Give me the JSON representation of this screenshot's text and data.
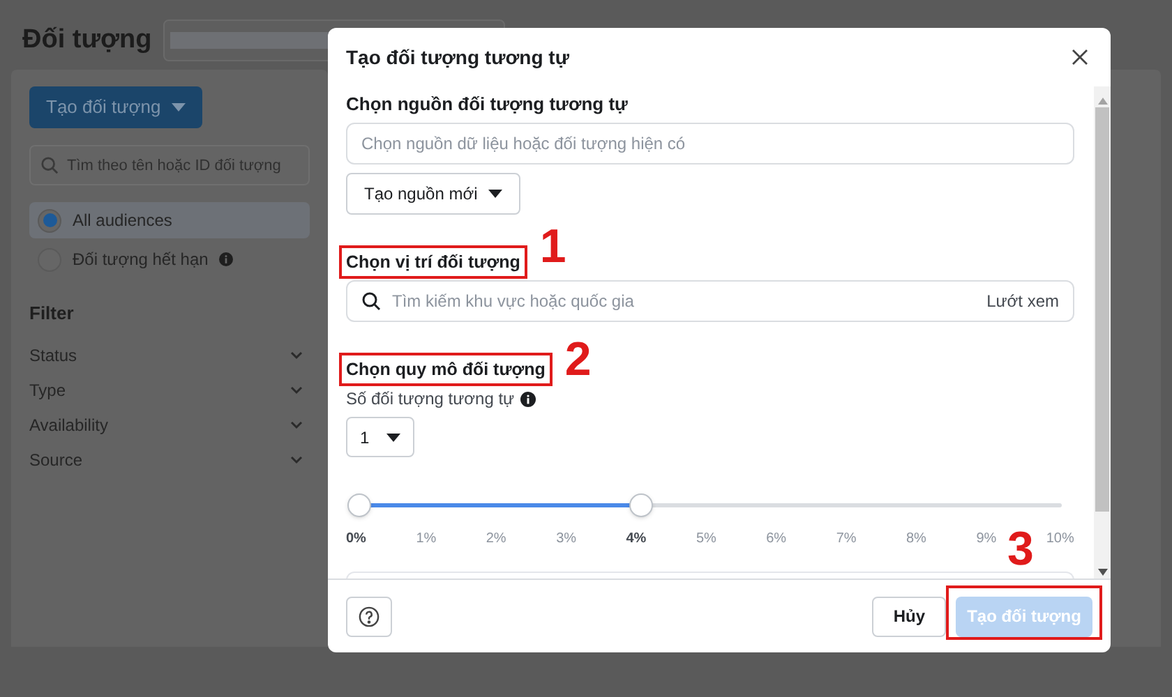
{
  "page": {
    "title": "Đối tượng",
    "create_button": "Tạo đối tượng",
    "search": {
      "placeholder": "Tìm theo tên hoặc ID đối tượng"
    },
    "views": [
      {
        "label": "All audiences",
        "selected": true,
        "info": false
      },
      {
        "label": "Đối tượng hết hạn",
        "selected": false,
        "info": true
      }
    ],
    "filter": {
      "title": "Filter",
      "items": [
        "Status",
        "Type",
        "Availability",
        "Source"
      ]
    }
  },
  "dialog": {
    "title": "Tạo đối tượng tương tự",
    "source": {
      "heading": "Chọn nguồn đối tượng tương tự",
      "placeholder": "Chọn nguồn dữ liệu hoặc đối tượng hiện có",
      "new_button": "Tạo nguồn mới"
    },
    "location": {
      "heading": "Chọn vị trí đối tượng",
      "placeholder": "Tìm kiếm khu vực hoặc quốc gia",
      "browse": "Lướt xem",
      "annotation": "1"
    },
    "size": {
      "heading": "Chọn quy mô đối tượng",
      "annotation": "2",
      "count_label": "Số đối tượng tương tự",
      "count_value": "1",
      "slider": {
        "level": 0.4,
        "ticks": [
          {
            "label": "0%",
            "bold": true
          },
          {
            "label": "1%",
            "bold": false
          },
          {
            "label": "2%",
            "bold": false
          },
          {
            "label": "3%",
            "bold": false
          },
          {
            "label": "4%",
            "bold": true
          },
          {
            "label": "5%",
            "bold": false
          },
          {
            "label": "6%",
            "bold": false
          },
          {
            "label": "7%",
            "bold": false
          },
          {
            "label": "8%",
            "bold": false
          },
          {
            "label": "9%",
            "bold": false
          },
          {
            "label": "10%",
            "bold": false
          }
        ]
      }
    },
    "footer": {
      "cancel": "Hủy",
      "create": "Tạo đối tượng",
      "create_disabled": true,
      "annotation": "3"
    }
  }
}
